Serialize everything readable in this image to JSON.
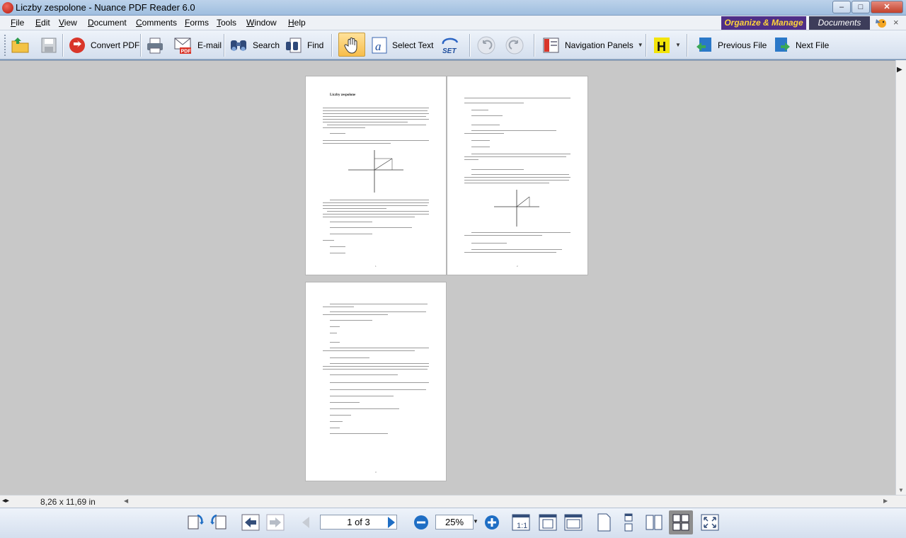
{
  "window": {
    "title": "Liczby zespolone - Nuance PDF Reader 6.0",
    "controls": {
      "minimize": "–",
      "maximize": "□",
      "close": "✕"
    }
  },
  "menu": [
    "File",
    "Edit",
    "View",
    "Document",
    "Comments",
    "Forms",
    "Tools",
    "Window",
    "Help"
  ],
  "workspace_tabs": {
    "organize": "Organize & Manage",
    "documents": "Documents",
    "close": "×"
  },
  "toolbar": {
    "open": {
      "icon": "open-folder-icon"
    },
    "save": {
      "icon": "save-icon"
    },
    "convert": {
      "label": "Convert PDF",
      "icon": "convert-pdf-icon"
    },
    "print": {
      "icon": "print-icon"
    },
    "email": {
      "label": "E-mail",
      "icon": "email-pdf-icon"
    },
    "search": {
      "label": "Search",
      "icon": "binoculars-icon"
    },
    "find": {
      "label": "Find",
      "icon": "find-icon"
    },
    "hand": {
      "icon": "hand-tool-icon",
      "active": true
    },
    "select_text": {
      "label": "Select Text",
      "icon": "select-text-icon"
    },
    "set": {
      "label": "SET",
      "icon": "set-icon"
    },
    "undo": {
      "icon": "undo-icon"
    },
    "redo": {
      "icon": "redo-icon"
    },
    "nav_panels": {
      "label": "Navigation Panels",
      "icon": "navigation-panels-icon"
    },
    "highlight": {
      "icon": "highlight-h-icon"
    },
    "prev_file": {
      "label": "Previous File",
      "icon": "previous-file-icon"
    },
    "next_file": {
      "label": "Next File",
      "icon": "next-file-icon"
    }
  },
  "document": {
    "pages": [
      {
        "title": "Liczby zespolone",
        "number": "1"
      },
      {
        "title": "",
        "number": "2"
      },
      {
        "title": "",
        "number": "3"
      }
    ]
  },
  "status": {
    "page_size": "8,26 x 11,69 in"
  },
  "navigation": {
    "page_display": "1 of 3",
    "zoom": "25%",
    "accent": "#1f6ec4"
  }
}
